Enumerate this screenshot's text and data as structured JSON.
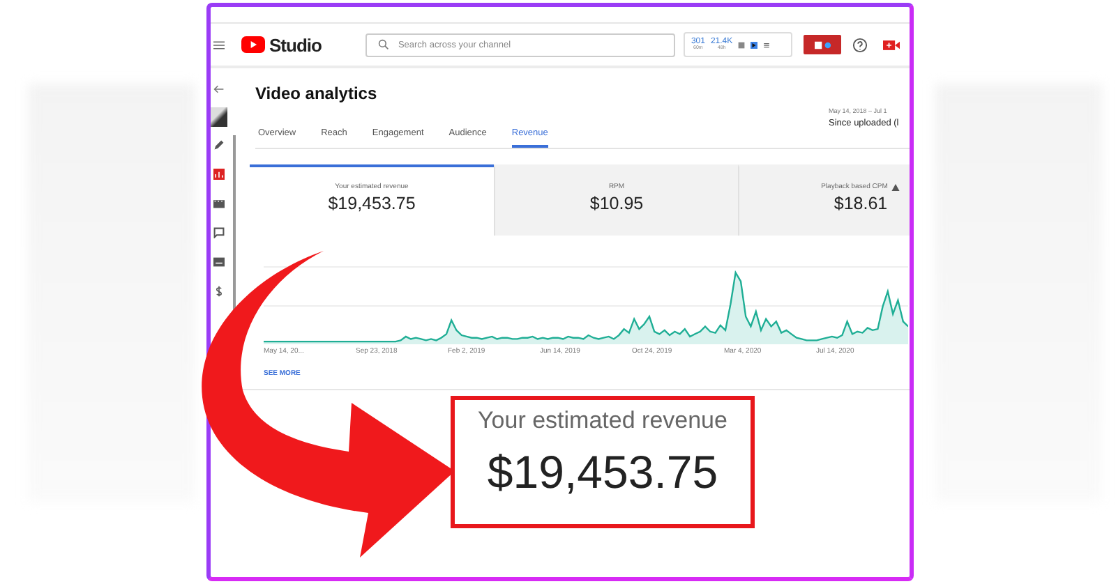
{
  "header": {
    "logo_text": "Studio",
    "search": {
      "placeholder": "Search across your channel"
    },
    "stats": [
      {
        "value": "301",
        "caption": "60m"
      },
      {
        "value": "21.4K",
        "caption": "48h"
      }
    ]
  },
  "page": {
    "title": "Video analytics",
    "date_range": "May 14, 2018 – Jul 1",
    "period": "Since uploaded (l"
  },
  "tabs": [
    {
      "label": "Overview",
      "selected": false
    },
    {
      "label": "Reach",
      "selected": false
    },
    {
      "label": "Engagement",
      "selected": false
    },
    {
      "label": "Audience",
      "selected": false
    },
    {
      "label": "Revenue",
      "selected": true
    }
  ],
  "metric_cards": [
    {
      "label": "Your estimated revenue",
      "value": "$19,453.75",
      "selected": true,
      "warning": false
    },
    {
      "label": "RPM",
      "value": "$10.95",
      "selected": false,
      "warning": false
    },
    {
      "label": "Playback based CPM",
      "value": "$18.61",
      "selected": false,
      "warning": true
    }
  ],
  "chart": {
    "x_labels": [
      "May 14, 20...",
      "Sep 23, 2018",
      "Feb 2, 2019",
      "Jun 14, 2019",
      "Oct 24, 2019",
      "Mar 4, 2020",
      "Jul 14, 2020"
    ]
  },
  "see_more": "SEE MORE",
  "callout": {
    "label": "Your estimated revenue",
    "value": "$19,453.75"
  }
}
